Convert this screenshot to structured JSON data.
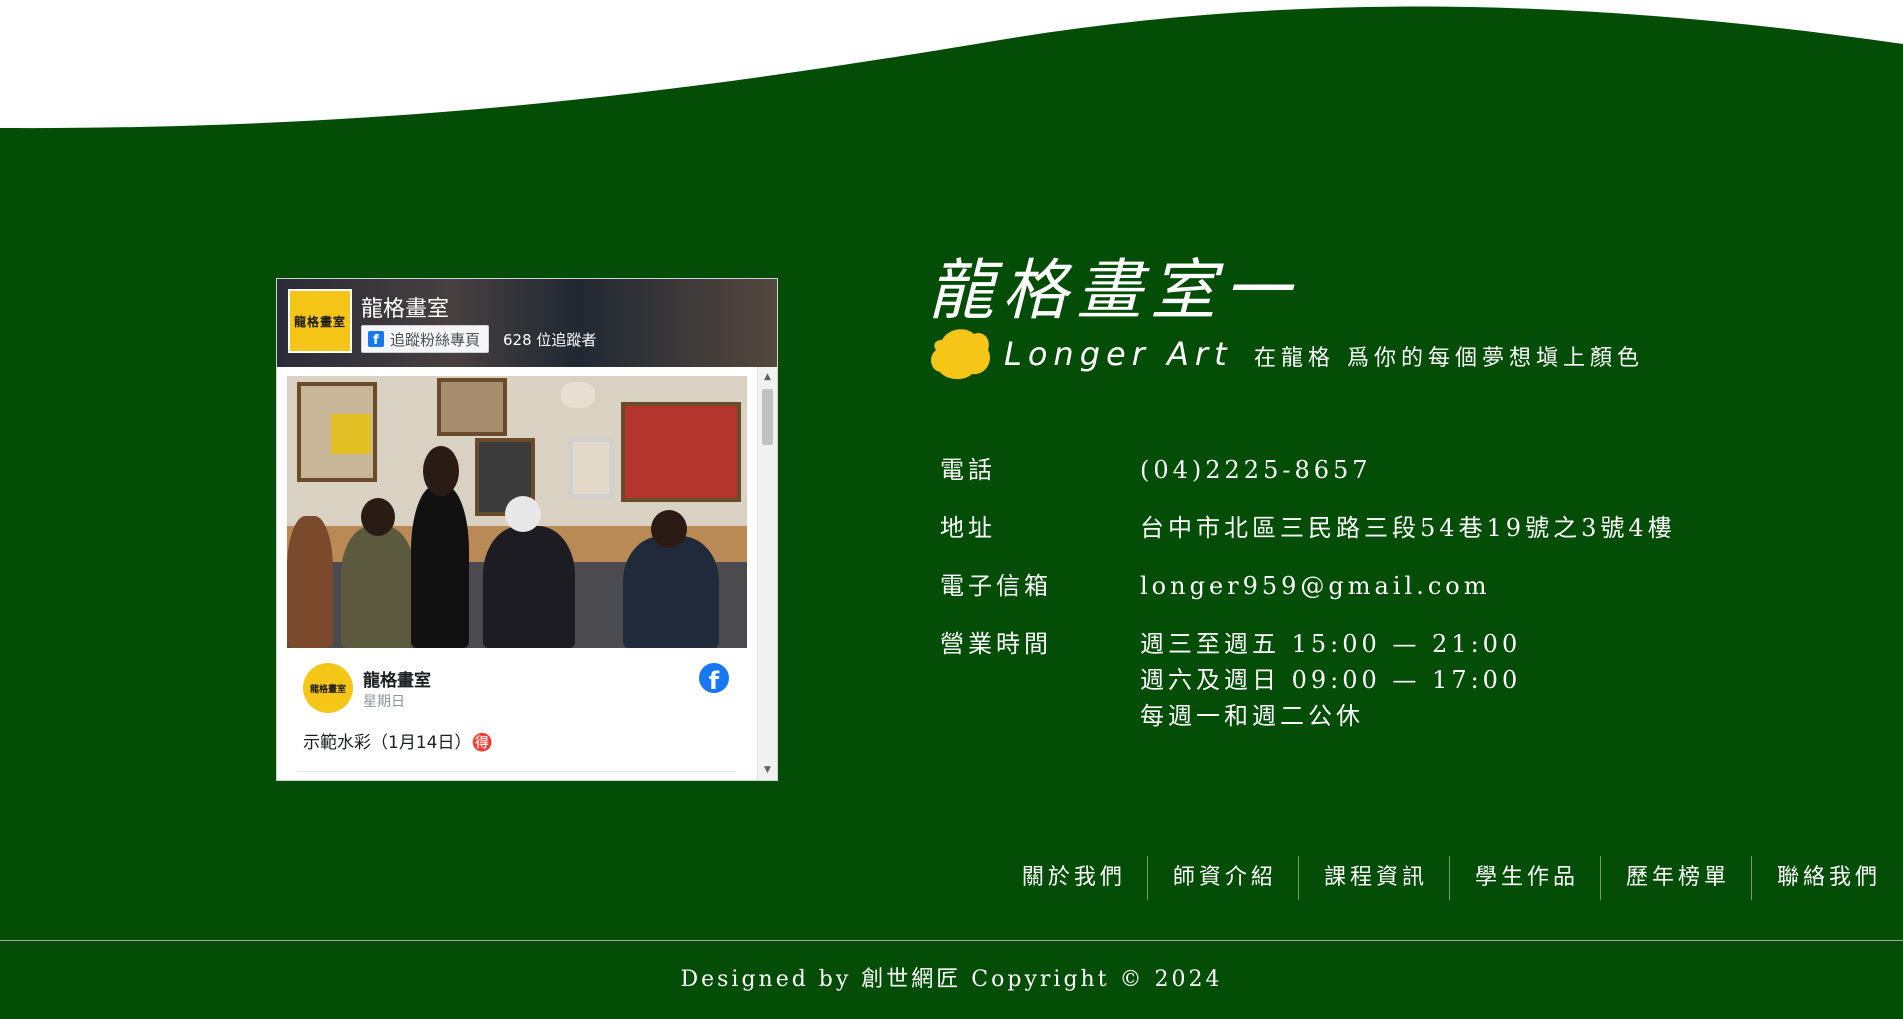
{
  "facebook_widget": {
    "page_name": "龍格畫室",
    "page_logo_text": "龍格畫室",
    "follow_button_label": "追蹤粉絲專頁",
    "followers": "628 位追蹤者",
    "post": {
      "avatar_text": "龍格畫室",
      "author": "龍格畫室",
      "date": "星期日",
      "text": "示範水彩（1月14日）🉐"
    }
  },
  "brand": {
    "title": "龍格畫室一",
    "subtitle_en": "Longer Art",
    "slogan": "在龍格 爲你的每個夢想塡上顏色"
  },
  "contact": {
    "phone": {
      "label": "電話",
      "value": "(04)2225-8657"
    },
    "address": {
      "label": "地址",
      "value": "台中市北區三民路三段54巷19號之3號4樓"
    },
    "email": {
      "label": "電子信箱",
      "value": "longer959@gmail.com"
    },
    "hours": {
      "label": "營業時間",
      "lines": [
        "週三至週五 15:00 — 21:00",
        "週六及週日 09:00 — 17:00",
        "每週一和週二公休"
      ]
    }
  },
  "footer_nav": [
    "關於我們",
    "師資介紹",
    "課程資訊",
    "學生作品",
    "歷年榜單",
    "聯絡我們"
  ],
  "copyright": "Designed by 創世網匠 Copyright © 2024",
  "colors": {
    "background": "#034d06",
    "accent_yellow": "#f5c518",
    "facebook_blue": "#1877f2"
  },
  "icons": [
    "facebook-f-icon",
    "facebook-logo-icon",
    "scroll-up-arrow-icon",
    "scroll-down-arrow-icon",
    "yellow-paint-blob"
  ]
}
